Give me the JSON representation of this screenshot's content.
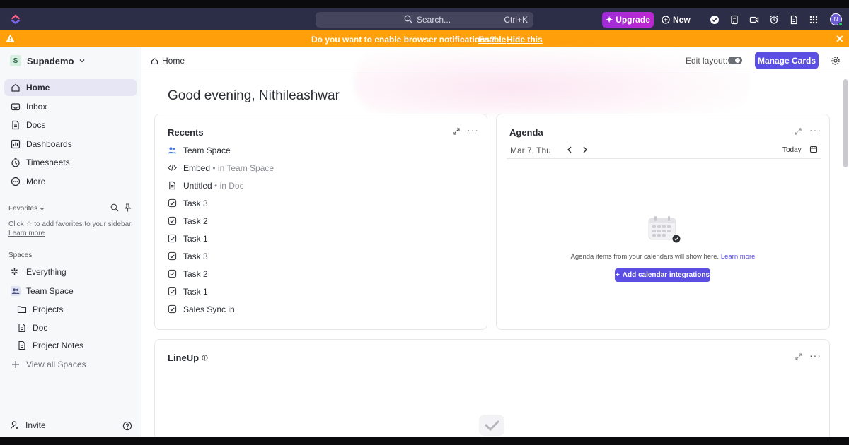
{
  "topbar": {
    "search_placeholder": "Search...",
    "search_shortcut": "Ctrl+K",
    "upgrade_label": "Upgrade",
    "new_label": "New",
    "avatar_initial": "N"
  },
  "banner": {
    "message": "Do you want to enable browser notifications?",
    "enable_label": "Enable",
    "hide_label": "Hide this",
    "color": "#ff9f0a"
  },
  "sidebar": {
    "workspace_badge": "S",
    "workspace_name": "Supademo",
    "nav": [
      {
        "label": "Home",
        "icon": "home-icon",
        "active": true
      },
      {
        "label": "Inbox",
        "icon": "inbox-icon"
      },
      {
        "label": "Docs",
        "icon": "docs-icon"
      },
      {
        "label": "Dashboards",
        "icon": "dashboards-icon"
      },
      {
        "label": "Timesheets",
        "icon": "timer-icon"
      },
      {
        "label": "More",
        "icon": "more-icon"
      }
    ],
    "favorites_title": "Favorites",
    "favorites_hint_prefix": "Click",
    "favorites_hint_suffix": "to add favorites to your sidebar.",
    "favorites_learn_more": "Learn more",
    "spaces_title": "Spaces",
    "spaces": [
      {
        "label": "Everything",
        "icon": "everything-icon"
      },
      {
        "label": "Team Space",
        "icon": "team-icon"
      },
      {
        "label": "Projects",
        "icon": "folder-icon",
        "sub": true
      },
      {
        "label": "Doc",
        "icon": "doc-icon",
        "sub": true
      },
      {
        "label": "Project Notes",
        "icon": "doc-icon",
        "sub": true
      },
      {
        "label": "View all Spaces",
        "icon": "plus-icon"
      }
    ],
    "invite_label": "Invite"
  },
  "main": {
    "breadcrumb": "Home",
    "edit_layout_label": "Edit layout:",
    "manage_cards_label": "Manage Cards",
    "greeting": "Good evening, Nithileashwar",
    "accent": "#5b4ee2"
  },
  "recents": {
    "title": "Recents",
    "items": [
      {
        "label": "Team Space",
        "sub": "",
        "icon": "team-icon"
      },
      {
        "label": "Embed",
        "sub": "• in Team Space",
        "icon": "code-icon"
      },
      {
        "label": "Untitled",
        "sub": "• in Doc",
        "icon": "doc-icon"
      },
      {
        "label": "Task 3",
        "sub": "",
        "icon": "task-icon"
      },
      {
        "label": "Task 2",
        "sub": "",
        "icon": "task-icon"
      },
      {
        "label": "Task 1",
        "sub": "",
        "icon": "task-icon"
      },
      {
        "label": "Task 3",
        "sub": "",
        "icon": "task-icon"
      },
      {
        "label": "Task 2",
        "sub": "",
        "icon": "task-icon"
      },
      {
        "label": "Task 1",
        "sub": "",
        "icon": "task-icon"
      },
      {
        "label": "Sales Sync in",
        "sub": "",
        "icon": "task-icon"
      }
    ]
  },
  "agenda": {
    "title": "Agenda",
    "date": "Mar 7, Thu",
    "today_label": "Today",
    "empty_message": "Agenda items from your calendars will show here.",
    "learn_more": "Learn more",
    "add_button": "Add calendar integrations"
  },
  "lineup": {
    "title": "LineUp"
  }
}
